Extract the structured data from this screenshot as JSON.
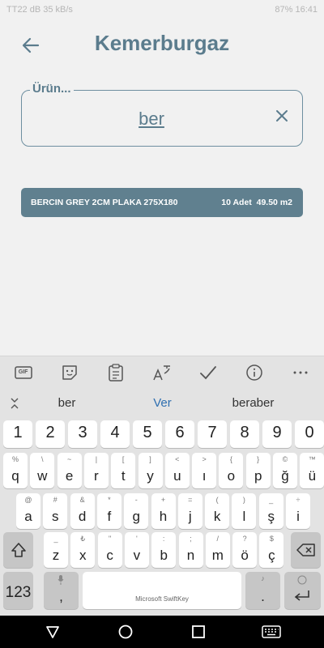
{
  "status_bar": {
    "left": "TT22 dB 35 kB/s",
    "right": "87% 16:41"
  },
  "header": {
    "title": "Kemerburgaz"
  },
  "search": {
    "label": "Ürün...",
    "value": "ber"
  },
  "result": {
    "name": "BERCIN GREY 2CM PLAKA 275X180",
    "qty": "10 Adet",
    "area": "49.50 m2"
  },
  "toolbar": {
    "items": [
      "gif-icon",
      "sticker-icon",
      "clipboard-icon",
      "translate-icon",
      "check-icon",
      "info-icon",
      "more-icon"
    ],
    "gif_label": "GIF"
  },
  "suggestions": [
    {
      "text": "ber",
      "highlight": false
    },
    {
      "text": "Ver",
      "highlight": true
    },
    {
      "text": "beraber",
      "highlight": false
    }
  ],
  "keyboard": {
    "numbers": [
      "1",
      "2",
      "3",
      "4",
      "5",
      "6",
      "7",
      "8",
      "9",
      "0"
    ],
    "row1": [
      {
        "m": "q",
        "s": "%"
      },
      {
        "m": "w",
        "s": "\\"
      },
      {
        "m": "e",
        "s": "~"
      },
      {
        "m": "r",
        "s": "|"
      },
      {
        "m": "t",
        "s": "["
      },
      {
        "m": "y",
        "s": "]"
      },
      {
        "m": "u",
        "s": "<"
      },
      {
        "m": "ı",
        "s": ">"
      },
      {
        "m": "o",
        "s": "{"
      },
      {
        "m": "p",
        "s": "}"
      },
      {
        "m": "ğ",
        "s": "©"
      },
      {
        "m": "ü",
        "s": "™"
      }
    ],
    "row2": [
      {
        "m": "a",
        "s": "@"
      },
      {
        "m": "s",
        "s": "#"
      },
      {
        "m": "d",
        "s": "&"
      },
      {
        "m": "f",
        "s": "*"
      },
      {
        "m": "g",
        "s": "-"
      },
      {
        "m": "h",
        "s": "+"
      },
      {
        "m": "j",
        "s": "="
      },
      {
        "m": "k",
        "s": "("
      },
      {
        "m": "l",
        "s": ")"
      },
      {
        "m": "ş",
        "s": "_"
      },
      {
        "m": "i",
        "s": "÷"
      }
    ],
    "row3": [
      {
        "m": "z",
        "s": "_"
      },
      {
        "m": "x",
        "s": "₺"
      },
      {
        "m": "c",
        "s": "\""
      },
      {
        "m": "v",
        "s": "'"
      },
      {
        "m": "b",
        "s": ":"
      },
      {
        "m": "n",
        "s": ";"
      },
      {
        "m": "m",
        "s": "/"
      },
      {
        "m": "ö",
        "s": "?"
      },
      {
        "m": "ç",
        "s": "$"
      }
    ],
    "symbols_label": "123",
    "comma": ",",
    "comma_sub": "mic",
    "space_label": "Microsoft SwiftKey",
    "period": ".",
    "period_sub": "♪"
  },
  "colors": {
    "accent": "#5b7c8d",
    "result_bg": "#60808f",
    "suggest_highlight": "#2f6fb0"
  }
}
